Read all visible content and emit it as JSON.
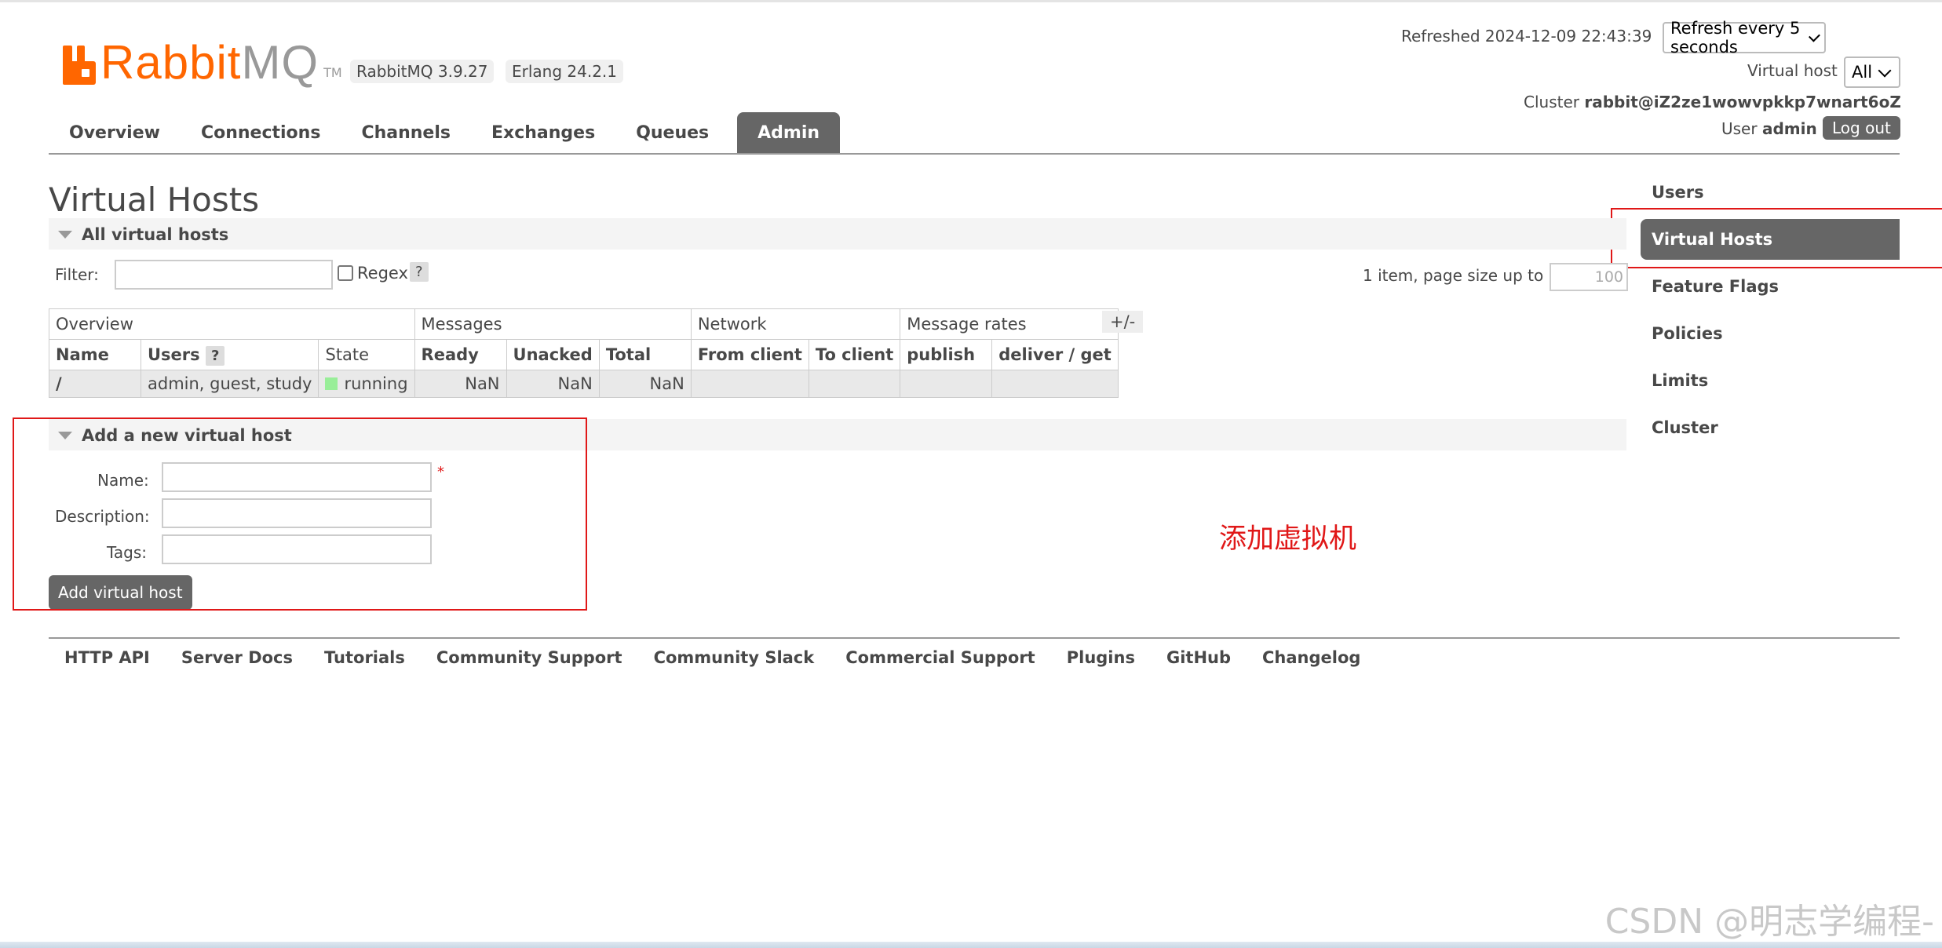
{
  "header": {
    "logo_rabbit": "Rabbit",
    "logo_mq": "MQ",
    "logo_tm": "TM",
    "rabbitmq_version": "RabbitMQ 3.9.27",
    "erlang_version": "Erlang 24.2.1",
    "refreshed_label": "Refreshed",
    "refreshed_time": "2024-12-09 22:43:39",
    "refresh_select": "Refresh every 5 seconds",
    "vhost_label": "Virtual host",
    "vhost_select": "All",
    "cluster_label": "Cluster",
    "cluster_name": "rabbit@iZ2ze1wowvpkkp7wnart6oZ",
    "user_label": "User",
    "user_name": "admin",
    "logout_label": "Log out"
  },
  "tabs": [
    {
      "label": "Overview"
    },
    {
      "label": "Connections"
    },
    {
      "label": "Channels"
    },
    {
      "label": "Exchanges"
    },
    {
      "label": "Queues"
    },
    {
      "label": "Admin",
      "active": true
    }
  ],
  "sidebar": {
    "items": [
      {
        "label": "Users"
      },
      {
        "label": "Virtual Hosts",
        "active": true
      },
      {
        "label": "Feature Flags"
      },
      {
        "label": "Policies"
      },
      {
        "label": "Limits"
      },
      {
        "label": "Cluster"
      }
    ]
  },
  "main": {
    "page_title": "Virtual Hosts",
    "all_section_title": "All virtual hosts",
    "filter_label": "Filter:",
    "regex_label": "Regex",
    "help_mark": "?",
    "paging_text": "1 item, page size up to",
    "page_size": "100",
    "plus_minus": "+/-",
    "table": {
      "groups": [
        "Overview",
        "Messages",
        "Network",
        "Message rates"
      ],
      "columns": [
        "Name",
        "Users",
        "State",
        "Ready",
        "Unacked",
        "Total",
        "From client",
        "To client",
        "publish",
        "deliver / get"
      ],
      "rows": [
        {
          "name": "/",
          "users": "admin, guest, study",
          "state": "running",
          "ready": "NaN",
          "unacked": "NaN",
          "total": "NaN",
          "from_client": "",
          "to_client": "",
          "publish": "",
          "deliver_get": ""
        }
      ]
    },
    "add_section_title": "Add a new virtual host",
    "name_label": "Name:",
    "required_mark": "*",
    "description_label": "Description:",
    "tags_label": "Tags:",
    "add_button": "Add virtual host"
  },
  "footer": {
    "links": [
      "HTTP API",
      "Server Docs",
      "Tutorials",
      "Community Support",
      "Community Slack",
      "Commercial Support",
      "Plugins",
      "GitHub",
      "Changelog"
    ]
  },
  "annotation_text": "添加虚拟机",
  "watermark": "CSDN @明志学编程-",
  "colors": {
    "brand_orange": "#ff6600",
    "tab_active": "#666666",
    "annotation_red": "#e01818",
    "state_running": "#99ee99"
  }
}
